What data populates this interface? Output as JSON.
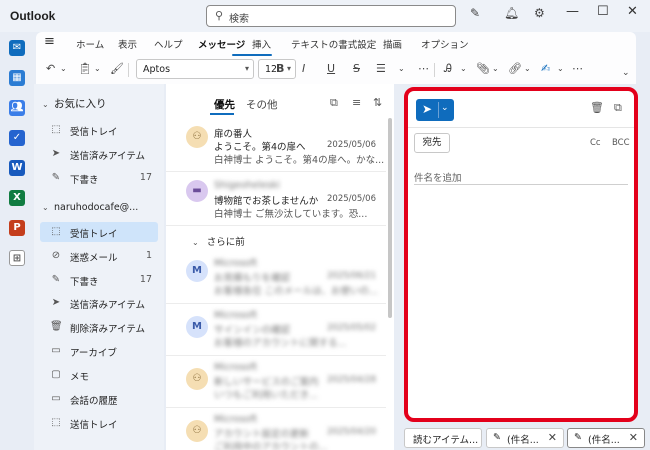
{
  "app": {
    "title": "Outlook"
  },
  "search": {
    "placeholder": "検索"
  },
  "ribbon": {
    "tabs": [
      {
        "label": "ホーム"
      },
      {
        "label": "表示"
      },
      {
        "label": "ヘルプ"
      },
      {
        "label": "メッセージ",
        "active": true
      },
      {
        "label": "挿入"
      },
      {
        "label": "テキストの書式設定"
      },
      {
        "label": "描画"
      },
      {
        "label": "オプション"
      }
    ],
    "font_name": "Aptos",
    "font_size": "12"
  },
  "folders": {
    "favorites_label": "お気に入り",
    "favorites": [
      {
        "label": "受信トレイ",
        "icon": "inbox-icon"
      },
      {
        "label": "送信済みアイテム",
        "icon": "send-icon"
      },
      {
        "label": "下書き",
        "count": "17",
        "icon": "pencil-icon"
      }
    ],
    "account_label": "naruhodocafe@...",
    "account_items": [
      {
        "label": "受信トレイ",
        "selected": true,
        "icon": "inbox-icon"
      },
      {
        "label": "迷惑メール",
        "count": "1",
        "icon": "junk-icon"
      },
      {
        "label": "下書き",
        "count": "17",
        "icon": "pencil-icon"
      },
      {
        "label": "送信済みアイテム",
        "icon": "send-icon"
      },
      {
        "label": "削除済みアイテム",
        "icon": "trash-icon"
      },
      {
        "label": "アーカイブ",
        "icon": "archive-icon"
      },
      {
        "label": "メモ",
        "icon": "note-icon"
      },
      {
        "label": "会話の履歴",
        "icon": "folder-icon"
      },
      {
        "label": "送信トレイ",
        "icon": "outbox-icon"
      }
    ]
  },
  "message_list": {
    "tabs": [
      {
        "label": "優先",
        "active": true
      },
      {
        "label": "その他"
      }
    ],
    "section_label": "さらに前",
    "messages": [
      {
        "sender": "扉の番人",
        "subject": "ようこそ。第4の扉へ",
        "date": "2025/05/06",
        "preview": "白神博士 ようこそ。第4の扉へ。かな...",
        "blurred": false
      },
      {
        "sender": "Shigeoheleski",
        "subject": "博物館でお茶しませんか",
        "date": "2025/05/06",
        "preview": "白神博士 ご無沙汰しています。恐...",
        "blurred": "sender"
      },
      {
        "sender": "Microsoft",
        "subject": "お見積もりを確認",
        "date": "2025/06/21",
        "preview": "お客様各位 このメールは、お使いの...",
        "blurred": true
      },
      {
        "sender": "Microsoft",
        "subject": "サインインの確認",
        "date": "2025/05/02",
        "preview": "お客様のアカウントに関する...",
        "blurred": true
      },
      {
        "sender": "Microsoft",
        "subject": "新しいサービスのご案内",
        "date": "2025/04/28",
        "preview": "いつもご利用いただき...",
        "blurred": true
      },
      {
        "sender": "Microsoft",
        "subject": "アカウント設定の更新",
        "date": "2025/04/20",
        "preview": "ご利用中のアカウントの...",
        "blurred": true
      }
    ]
  },
  "compose": {
    "to_label": "宛先",
    "cc_label": "Cc",
    "bcc_label": "BCC",
    "subject_placeholder": "件名を追加"
  },
  "bottom_tabs": [
    {
      "label": "読むアイテム..."
    },
    {
      "label": "(件名..."
    },
    {
      "label": "(件名..."
    }
  ],
  "colors": {
    "accent": "#0f6cbd",
    "highlight": "#e3001b",
    "selected": "#cfe4fa"
  }
}
